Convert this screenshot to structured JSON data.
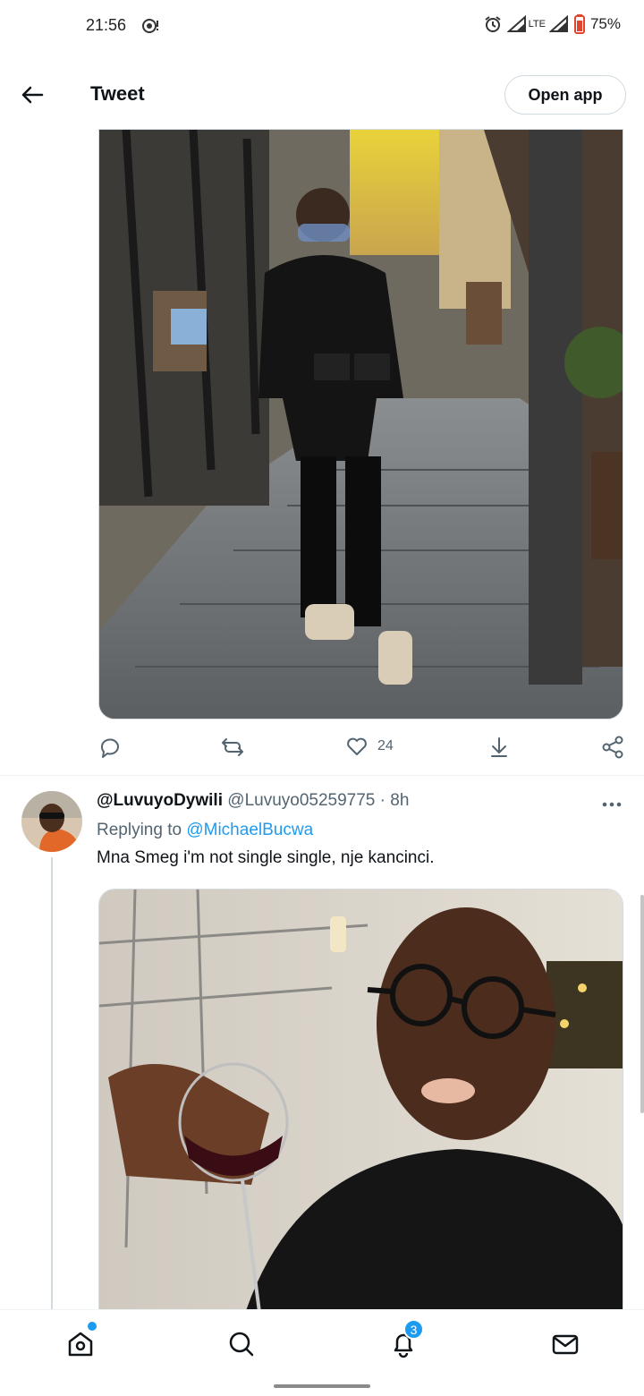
{
  "status_bar": {
    "time": "21:56",
    "battery": "75%",
    "network": "LTE",
    "icons": [
      "whatsapp-notification-icon",
      "alarm-icon",
      "signal-icon",
      "signal-icon",
      "battery-icon"
    ]
  },
  "header": {
    "title": "Tweet",
    "open_app_label": "Open app",
    "back_icon": "back-arrow-icon"
  },
  "main_tweet": {
    "photo_description_icon": "photo",
    "actions": {
      "reply_count": "",
      "retweet_count": "",
      "like_count": "24",
      "bookmark_count": ""
    }
  },
  "reply": {
    "display_name": "@LuvuyoDywili",
    "handle": "@Luvuyo05259775",
    "separator": "·",
    "time": "8h",
    "replying_label": "Replying to",
    "replying_to": "@MichaelBucwa",
    "text": "Mna Smeg i'm not single single, nje kancinci."
  },
  "bottom_nav": {
    "items": [
      "home-icon",
      "search-icon",
      "notifications-icon",
      "messages-icon"
    ],
    "notifications_badge": "3",
    "colors": {
      "accent": "#1d9bf0"
    }
  }
}
